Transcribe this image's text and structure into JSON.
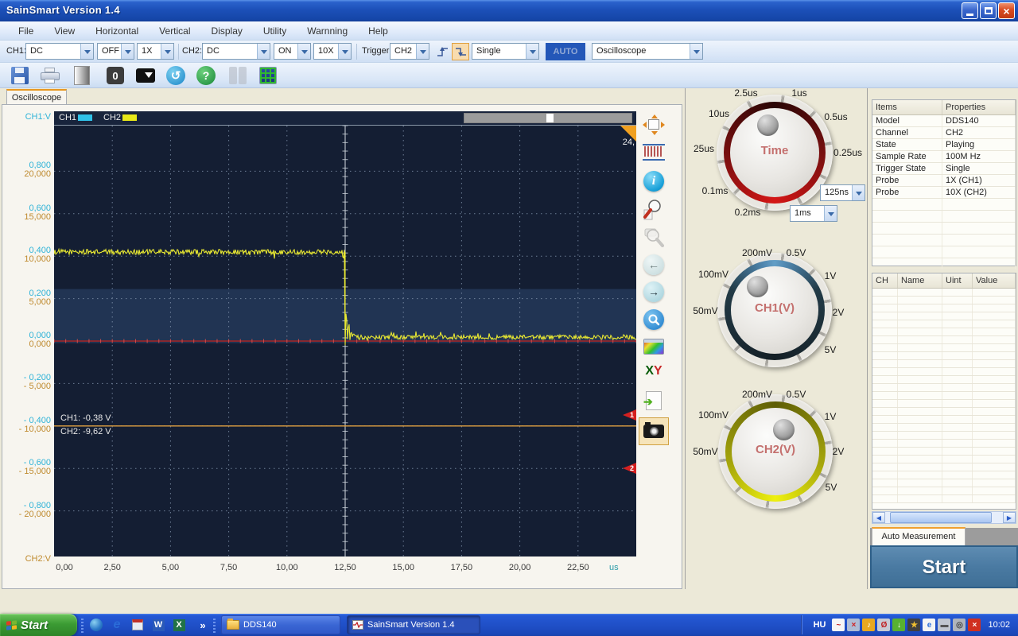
{
  "window": {
    "title": "SainSmart  Version 1.4"
  },
  "menu": {
    "items": [
      "File",
      "View",
      "Horizontal",
      "Vertical",
      "Display",
      "Utility",
      "Warnning",
      "Help"
    ]
  },
  "toolbar": {
    "ch1_label": "CH1:",
    "ch1_coupling": "DC",
    "ch1_display": "OFF",
    "ch1_probe": "1X",
    "ch2_label": "CH2:",
    "ch2_coupling": "DC",
    "ch2_display": "ON",
    "ch2_probe": "10X",
    "trigger_label": "Trigger",
    "trigger_source": "CH2",
    "trigger_mode": "Single",
    "auto_button": "AUTO",
    "device_mode": "Oscilloscope",
    "record_count": "0"
  },
  "tabs": {
    "oscilloscope": "Oscilloscope",
    "auto_measurement": "Auto Measurement"
  },
  "scope": {
    "legend_ch1": "CH1",
    "legend_ch2": "CH2",
    "axis_top_label": "CH1:V",
    "axis_bottom_label": "CH2:V",
    "corner_value": "24,",
    "marker1": "1",
    "marker2": "2",
    "cursor_ch1": "CH1: -0,38 V",
    "cursor_ch2": "CH2: -9,62 V",
    "y_ticks": [
      {
        "ch1": "0,800",
        "ch2": "20,000"
      },
      {
        "ch1": "0,600",
        "ch2": "15,000"
      },
      {
        "ch1": "0,400",
        "ch2": "10,000"
      },
      {
        "ch1": "0,200",
        "ch2": "5,000"
      },
      {
        "ch1": "0,000",
        "ch2": "0,000"
      },
      {
        "ch1": "- 0,200",
        "ch2": "- 5,000"
      },
      {
        "ch1": "- 0,400",
        "ch2": "- 10,000"
      },
      {
        "ch1": "- 0,600",
        "ch2": "- 15,000"
      },
      {
        "ch1": "- 0,800",
        "ch2": "- 20,000"
      }
    ],
    "x_ticks": [
      "0,00",
      "2,50",
      "5,00",
      "7,50",
      "10,00",
      "12,50",
      "15,00",
      "17,50",
      "20,00",
      "22,50"
    ],
    "x_unit": "us",
    "colors": {
      "ch1": "#30c1e8",
      "ch2": "#e8e832",
      "bg": "#141e33",
      "band": "#213453",
      "axis_red": "#a82424",
      "cursor": "#e0a040"
    }
  },
  "chart_data": {
    "type": "line",
    "title": "DDS140 oscilloscope capture, CH2 step waveform",
    "xlabel": "time (us)",
    "x_range": [
      0,
      25
    ],
    "ylabel": "CH1 scale (V)",
    "y_range_ch1_V": [
      -1.0,
      1.0
    ],
    "y_range_ch2_V": [
      -25,
      25
    ],
    "trigger_time_us": 12.5,
    "cursor_level_ch1_V": -0.4,
    "highlight_band_ch1_V": [
      -0.01,
      0.245
    ],
    "series": [
      {
        "name": "CH2",
        "color": "#e8e832",
        "description": "high level ~0.42 V (CH1 display scale) from 0 to 12.5 us, sharp falling step at 12.5 us with damped ringing until ~13.6 us, settles at ~0.02 V until 25 us",
        "segments": [
          {
            "type": "flat",
            "x0": 0,
            "x1": 12.5,
            "level": 0.42,
            "noise": 0.012
          },
          {
            "type": "step",
            "x": 12.5,
            "from": 0.42,
            "to": 0.0
          },
          {
            "type": "ringing",
            "x0": 12.5,
            "x1": 13.6,
            "base": 0.015,
            "amplitude": 0.15,
            "decay_us": 0.18,
            "spike_freq": 30
          },
          {
            "type": "flat",
            "x0": 13.6,
            "x1": 25,
            "level": 0.018,
            "noise": 0.01
          }
        ]
      }
    ],
    "annotations": [
      "CH1: -0,38 V",
      "CH2: -9,62 V"
    ]
  },
  "side_toolbar": {
    "icons": [
      "fit-screen",
      "sampling-comb",
      "info",
      "zoom-in",
      "zoom-out",
      "back",
      "forward",
      "search",
      "palette",
      "xy-mode",
      "export",
      "snapshot-camera"
    ]
  },
  "knobs": {
    "time": {
      "label": "Time",
      "dial_values": [
        "2.5us",
        "1us",
        "10us",
        "0.5us",
        "25us",
        "0.25us",
        "0.1ms",
        "0.2ms"
      ],
      "combo_fine": "125ns",
      "combo_coarse": "1ms"
    },
    "ch1": {
      "label": "CH1(V)",
      "dial_values": [
        "200mV",
        "0.5V",
        "100mV",
        "1V",
        "50mV",
        "2V",
        "5V"
      ]
    },
    "ch2": {
      "label": "CH2(V)",
      "dial_values": [
        "200mV",
        "0.5V",
        "100mV",
        "1V",
        "50mV",
        "2V",
        "5V"
      ]
    }
  },
  "properties_panel": {
    "headers": [
      "Items",
      "Properties"
    ],
    "rows": [
      [
        "Model",
        "DDS140"
      ],
      [
        "Channel",
        "CH2"
      ],
      [
        "State",
        "Playing"
      ],
      [
        "Sample Rate",
        "100M Hz"
      ],
      [
        "Trigger State",
        "Single"
      ],
      [
        "Probe",
        "1X (CH1)"
      ],
      [
        "Probe",
        "10X (CH2)"
      ]
    ]
  },
  "measurement_panel": {
    "headers": [
      "CH",
      "Name",
      "Uint",
      "Value"
    ],
    "rows": []
  },
  "start_button": "Start",
  "taskbar": {
    "start": "Start",
    "quick_launch": [
      "internet",
      "browser-e",
      "floppy",
      "word",
      "excel"
    ],
    "overflow_chevron": "»",
    "tasks": [
      {
        "label": "DDS140",
        "icon": "folder"
      },
      {
        "label": "SainSmart  Version 1.4",
        "icon": "scope"
      }
    ],
    "language": "HU",
    "clock": "10:02",
    "tray_icons": [
      "scope",
      "network-offline",
      "volume",
      "blocked",
      "update",
      "program",
      "ie-doc",
      "display",
      "hardware",
      "security"
    ]
  }
}
